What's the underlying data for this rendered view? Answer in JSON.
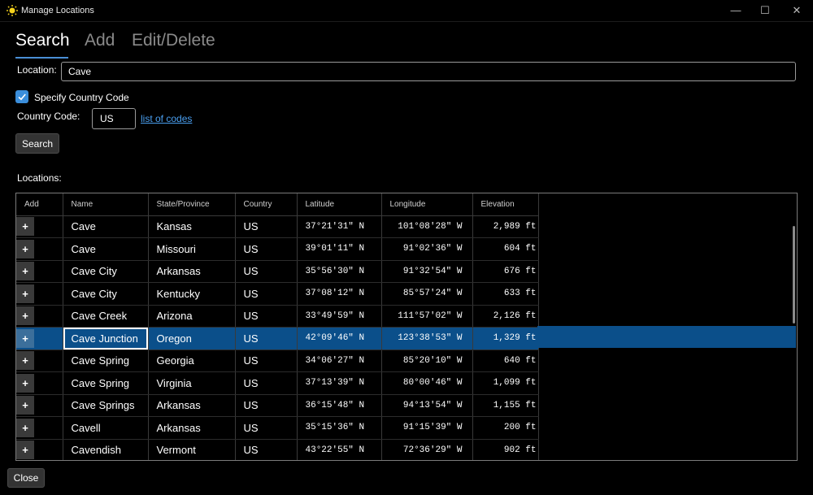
{
  "window": {
    "title": "Manage Locations",
    "minimize_label": "—",
    "maximize_label": "☐",
    "close_label": "✕"
  },
  "tabs": [
    {
      "label": "Search",
      "selected": true
    },
    {
      "label": "Add",
      "selected": false
    },
    {
      "label": "Edit/Delete",
      "selected": false
    }
  ],
  "search": {
    "location_label": "Location:",
    "location_value": "Cave",
    "specify_country_label": "Specify Country Code",
    "specify_country_checked": true,
    "country_code_label": "Country Code:",
    "country_code_value": "US",
    "codes_link": "list of codes",
    "search_button": "Search"
  },
  "results": {
    "label": "Locations:",
    "columns": [
      "Add",
      "Name",
      "State/Province",
      "Country",
      "Latitude",
      "Longitude",
      "Elevation"
    ],
    "add_glyph": "+",
    "rows": [
      {
        "name": "Cave",
        "state": "Kansas",
        "country": "US",
        "lat": "37°21'31\" N",
        "lon": "101°08'28\" W",
        "elev": "2,989 ft"
      },
      {
        "name": "Cave",
        "state": "Missouri",
        "country": "US",
        "lat": "39°01'11\" N",
        "lon": "91°02'36\" W",
        "elev": "604 ft"
      },
      {
        "name": "Cave City",
        "state": "Arkansas",
        "country": "US",
        "lat": "35°56'30\" N",
        "lon": "91°32'54\" W",
        "elev": "676 ft"
      },
      {
        "name": "Cave City",
        "state": "Kentucky",
        "country": "US",
        "lat": "37°08'12\" N",
        "lon": "85°57'24\" W",
        "elev": "633 ft"
      },
      {
        "name": "Cave Creek",
        "state": "Arizona",
        "country": "US",
        "lat": "33°49'59\" N",
        "lon": "111°57'02\" W",
        "elev": "2,126 ft"
      },
      {
        "name": "Cave Junction",
        "state": "Oregon",
        "country": "US",
        "lat": "42°09'46\" N",
        "lon": "123°38'53\" W",
        "elev": "1,329 ft",
        "selected": true
      },
      {
        "name": "Cave Spring",
        "state": "Georgia",
        "country": "US",
        "lat": "34°06'27\" N",
        "lon": "85°20'10\" W",
        "elev": "640 ft"
      },
      {
        "name": "Cave Spring",
        "state": "Virginia",
        "country": "US",
        "lat": "37°13'39\" N",
        "lon": "80°00'46\" W",
        "elev": "1,099 ft"
      },
      {
        "name": "Cave Springs",
        "state": "Arkansas",
        "country": "US",
        "lat": "36°15'48\" N",
        "lon": "94°13'54\" W",
        "elev": "1,155 ft"
      },
      {
        "name": "Cavell",
        "state": "Arkansas",
        "country": "US",
        "lat": "35°15'36\" N",
        "lon": "91°15'39\" W",
        "elev": "200 ft"
      },
      {
        "name": "Cavendish",
        "state": "Vermont",
        "country": "US",
        "lat": "43°22'55\" N",
        "lon": "72°36'29\" W",
        "elev": "902 ft"
      }
    ]
  },
  "footer": {
    "close_button": "Close"
  },
  "colors": {
    "accent": "#3b8edb",
    "selection": "#0b4f8a",
    "link": "#4a9ff0",
    "background": "#000000"
  }
}
